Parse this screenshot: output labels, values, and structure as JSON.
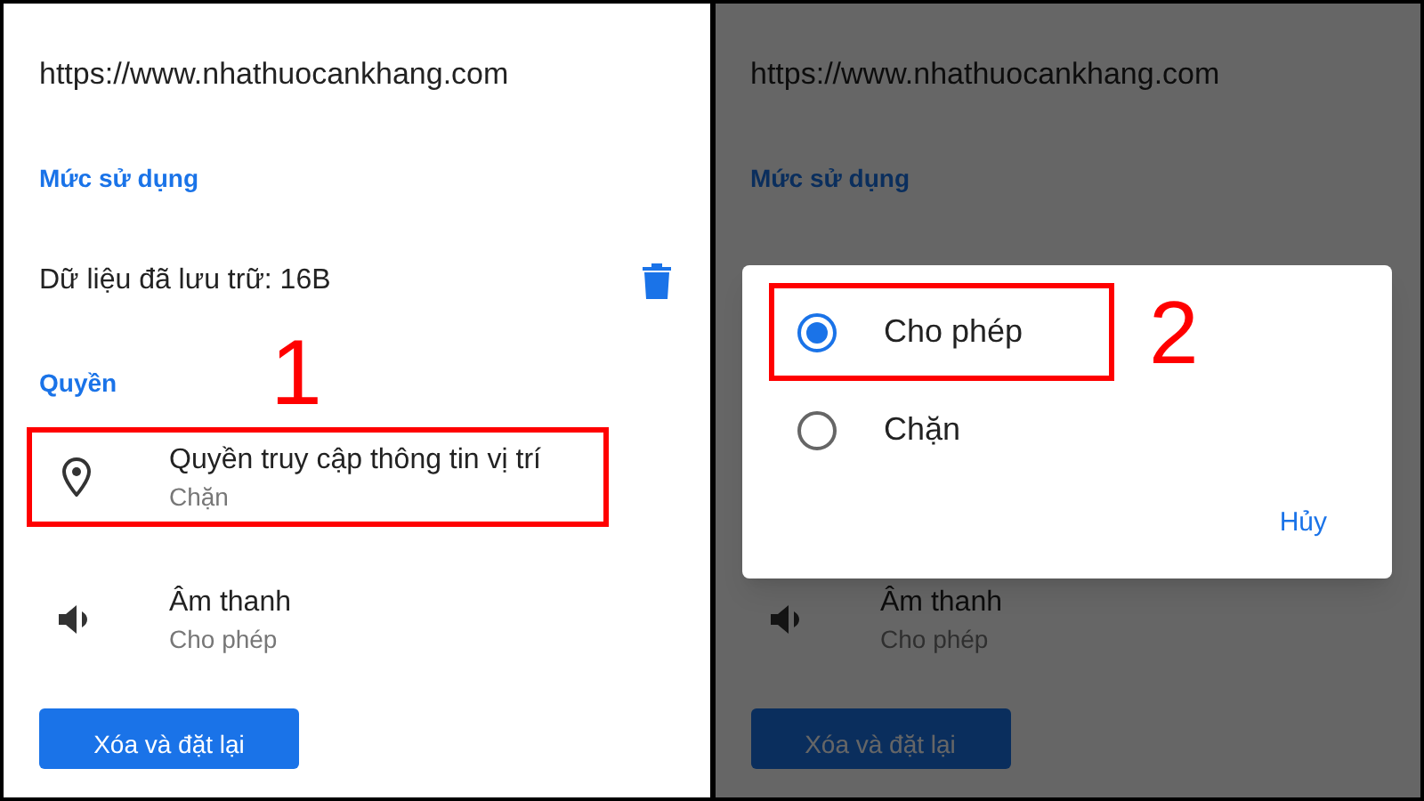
{
  "screens": [
    {
      "dimmed": false,
      "url": "https://www.nhathuocankhang.com",
      "usage_heading": "Mức sử dụng",
      "storage": {
        "text": "Dữ liệu đã lưu trữ: 16B"
      },
      "permissions_heading": "Quyền",
      "step_label": "1",
      "permissions": [
        {
          "kind": "location",
          "title": "Quyền truy cập thông tin vị trí",
          "value": "Chặn",
          "highlighted": true
        },
        {
          "kind": "sound",
          "title": "Âm thanh",
          "value": "Cho phép",
          "highlighted": false
        }
      ],
      "reset_button": "Xóa và đặt lại"
    },
    {
      "dimmed": true,
      "url": "https://www.nhathuocankhang.com",
      "usage_heading": "Mức sử dụng",
      "permissions": [
        {
          "kind": "sound",
          "title": "Âm thanh",
          "value": "Cho phép",
          "highlighted": false
        }
      ],
      "reset_button": "Xóa và đặt lại",
      "dialog": {
        "step_label": "2",
        "options": [
          {
            "label": "Cho phép",
            "selected": true,
            "highlighted": true
          },
          {
            "label": "Chặn",
            "selected": false,
            "highlighted": false
          }
        ],
        "cancel": "Hủy"
      }
    }
  ]
}
